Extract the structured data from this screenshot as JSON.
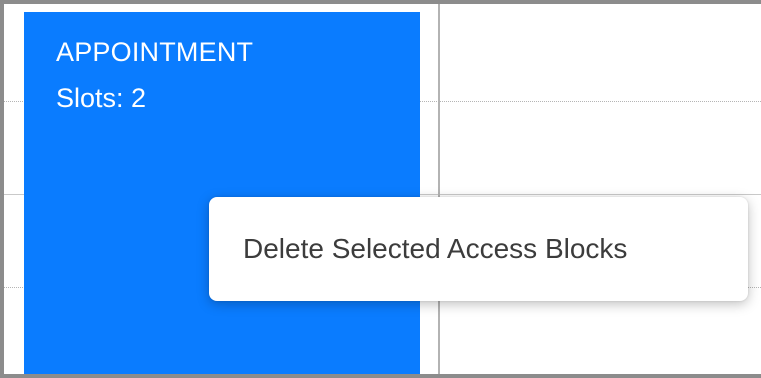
{
  "appointment": {
    "title": "APPOINTMENT",
    "slots": "Slots: 2",
    "color": "#0a7cff"
  },
  "context_menu": {
    "items": [
      {
        "label": "Delete Selected Access Blocks"
      }
    ]
  }
}
